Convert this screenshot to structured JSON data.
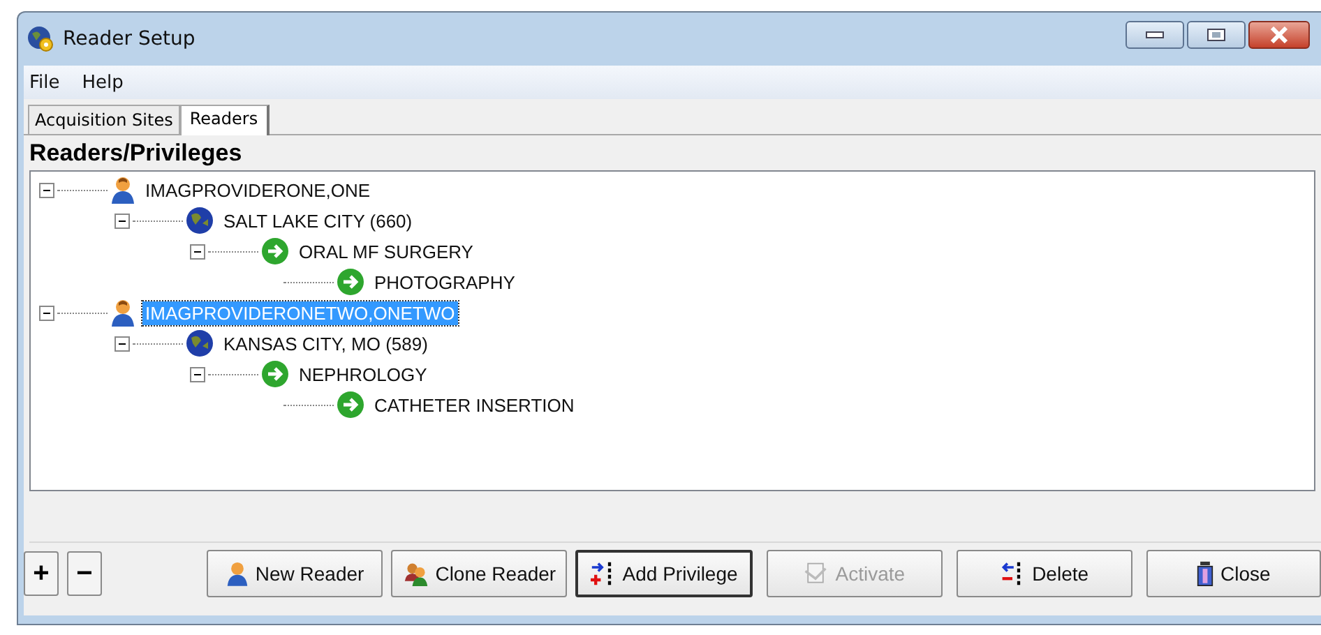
{
  "window": {
    "title": "Reader Setup"
  },
  "menu": [
    "File",
    "Help"
  ],
  "tabs": [
    {
      "label": "Acquisition Sites",
      "selected": false
    },
    {
      "label": "Readers",
      "selected": true
    }
  ],
  "heading": "Readers/Privileges",
  "tree": [
    {
      "kind": "reader",
      "label": "IMAGPROVIDERONE,ONE",
      "selected": false,
      "expanded": true,
      "children": [
        {
          "kind": "site",
          "label": "SALT LAKE CITY (660)",
          "selected": false,
          "expanded": true,
          "children": [
            {
              "kind": "privilege",
              "label": "ORAL MF SURGERY",
              "selected": false,
              "expanded": true,
              "children": [
                {
                  "kind": "privilege",
                  "label": "PHOTOGRAPHY",
                  "selected": false
                }
              ]
            }
          ]
        }
      ]
    },
    {
      "kind": "reader",
      "label": "IMAGPROVIDERONETWO,ONETWO",
      "selected": true,
      "expanded": true,
      "children": [
        {
          "kind": "site",
          "label": "KANSAS CITY, MO (589)",
          "selected": false,
          "expanded": true,
          "children": [
            {
              "kind": "privilege",
              "label": "NEPHROLOGY",
              "selected": false,
              "expanded": true,
              "children": [
                {
                  "kind": "privilege",
                  "label": "CATHETER INSERTION",
                  "selected": false
                }
              ]
            }
          ]
        }
      ]
    }
  ],
  "zoom_buttons": [
    "+",
    "−"
  ],
  "buttons": [
    {
      "kind": "new",
      "label": "New Reader",
      "disabled": false,
      "default": false
    },
    {
      "kind": "clone",
      "label": "Clone Reader",
      "disabled": false,
      "default": false
    },
    {
      "kind": "add",
      "label": "Add Privilege",
      "disabled": false,
      "default": true
    },
    {
      "kind": "activate",
      "label": "Activate",
      "disabled": true,
      "default": false
    },
    {
      "kind": "delete",
      "label": "Delete",
      "disabled": false,
      "default": false
    },
    {
      "kind": "close",
      "label": "Close",
      "disabled": false,
      "default": false
    }
  ]
}
